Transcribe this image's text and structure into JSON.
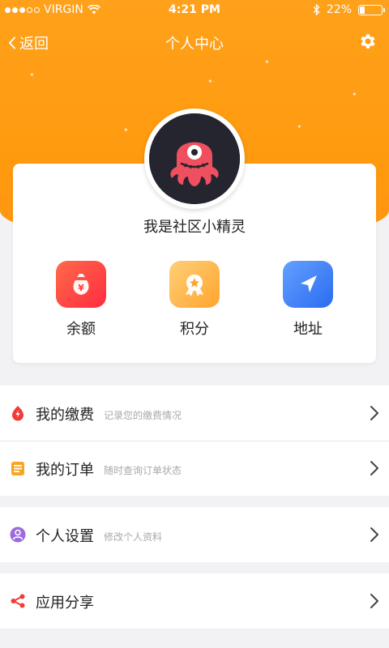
{
  "status_bar": {
    "carrier": "VIRGIN",
    "time": "4:21 PM",
    "battery": "22%",
    "battery_level": 0.22,
    "signal_bars": 3
  },
  "nav": {
    "back_label": "返回",
    "title": "个人中心",
    "settings_icon": "gear-icon"
  },
  "profile": {
    "username": "我是社区小精灵"
  },
  "quick_actions": [
    {
      "label": "余额",
      "icon": "money-bag-icon",
      "color_from": "#ff5a45",
      "color_to": "#ff2e3e"
    },
    {
      "label": "积分",
      "icon": "medal-icon",
      "color_from": "#ffc86b",
      "color_to": "#ffa52e"
    },
    {
      "label": "地址",
      "icon": "location-arrow-icon",
      "color_from": "#5b97ff",
      "color_to": "#2c6ff2"
    }
  ],
  "menu": [
    {
      "title": "我的缴费",
      "subtitle": "记录您的缴费情况",
      "icon": "payment-icon",
      "color": "#f23a3a"
    },
    {
      "title": "我的订单",
      "subtitle": "随时查询订单状态",
      "icon": "order-icon",
      "color": "#f6a623"
    },
    {
      "title": "个人设置",
      "subtitle": "修改个人资料",
      "icon": "user-settings-icon",
      "color": "#9b6bdf"
    },
    {
      "title": "应用分享",
      "subtitle": "",
      "icon": "share-icon",
      "color": "#f23a3a"
    }
  ],
  "colors": {
    "accent": "#ff9a12",
    "background": "#f2f2f4"
  }
}
